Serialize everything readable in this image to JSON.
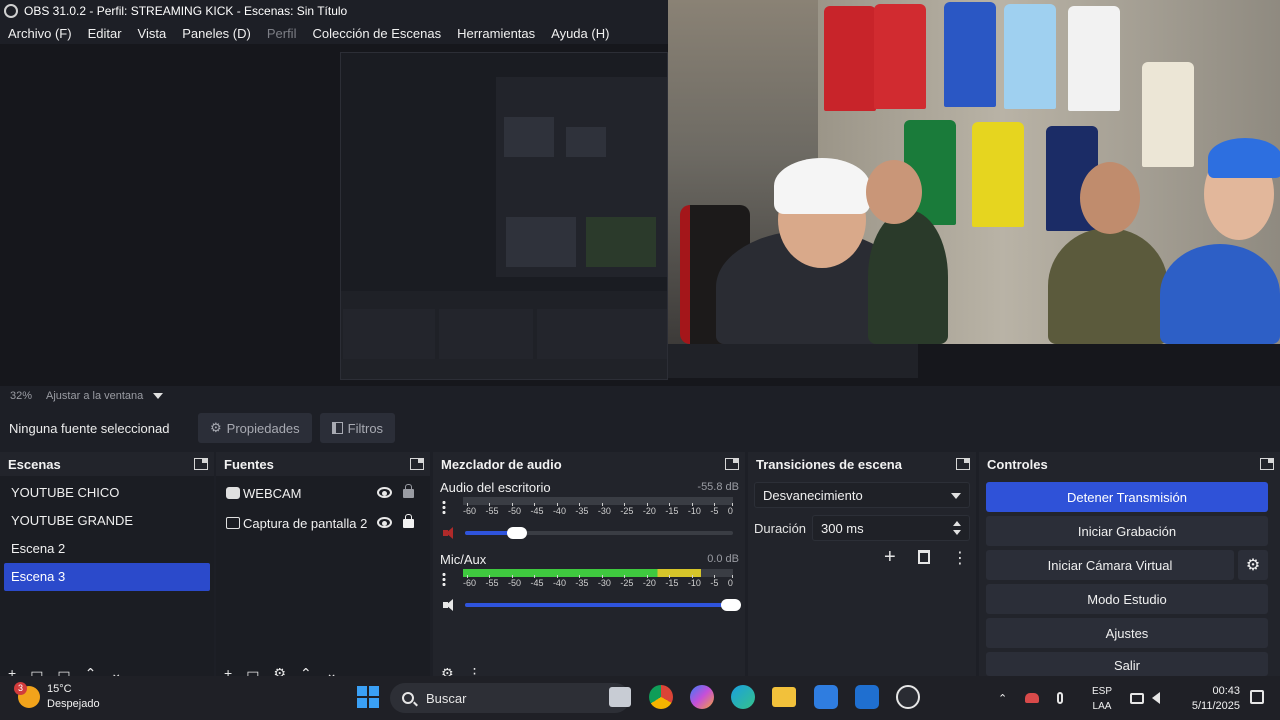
{
  "window": {
    "title": "OBS 31.0.2 - Perfil: STREAMING KICK - Escenas: Sin Título"
  },
  "menu": [
    "Archivo (F)",
    "Editar",
    "Vista",
    "Paneles (D)",
    "Perfil",
    "Colección de Escenas",
    "Herramientas",
    "Ayuda (H)"
  ],
  "preview": {
    "zoom": "32%",
    "zoom_label": "Ajustar a la ventana"
  },
  "context_bar": {
    "no_source": "Ninguna fuente seleccionad",
    "properties_button": "Propiedades",
    "filters_button": "Filtros"
  },
  "scenes": {
    "title": "Escenas",
    "items": [
      "YOUTUBE CHICO",
      "YOUTUBE GRANDE",
      "Escena 2",
      "Escena 3"
    ],
    "selected_index": 3
  },
  "sources": {
    "title": "Fuentes",
    "items": [
      {
        "name": "WEBCAM",
        "icon": "camera-icon",
        "visible": true,
        "locked": false
      },
      {
        "name": "Captura de pantalla 2",
        "icon": "display-icon",
        "visible": true,
        "locked": true
      }
    ]
  },
  "mixer": {
    "title": "Mezclador de audio",
    "ticks": [
      "-60",
      "-55",
      "-50",
      "-45",
      "-40",
      "-35",
      "-30",
      "-25",
      "-20",
      "-15",
      "-10",
      "-5",
      "0"
    ],
    "channels": [
      {
        "name": "Audio del escritorio",
        "db": "-55.8 dB",
        "muted": true,
        "volume": 0.2,
        "level": 0.0
      },
      {
        "name": "Mic/Aux",
        "db": "0.0 dB",
        "muted": false,
        "volume": 1.0,
        "level": 0.88
      }
    ]
  },
  "transitions": {
    "title": "Transiciones de escena",
    "selected": "Desvanecimiento",
    "duration_label": "Duración",
    "duration_value": "300 ms"
  },
  "controls": {
    "title": "Controles",
    "buttons": [
      "Detener Transmisión",
      "Iniciar Grabación",
      "Iniciar Cámara Virtual",
      "Modo Estudio",
      "Ajustes",
      "Salir"
    ]
  },
  "taskbar": {
    "weather_temp": "15°C",
    "weather_desc": "Despejado",
    "weather_badge": "3",
    "search_placeholder": "Buscar",
    "lang_line1": "ESP",
    "lang_line2": "LAA",
    "time": "00:43",
    "date": "5/11/2025"
  },
  "colors": {
    "accent": "#2f52d8",
    "selected_scene": "#2b4acb",
    "meter_green": "#3fc93f",
    "meter_yellow": "#d6c52a",
    "meter_red": "#c42b2b"
  }
}
